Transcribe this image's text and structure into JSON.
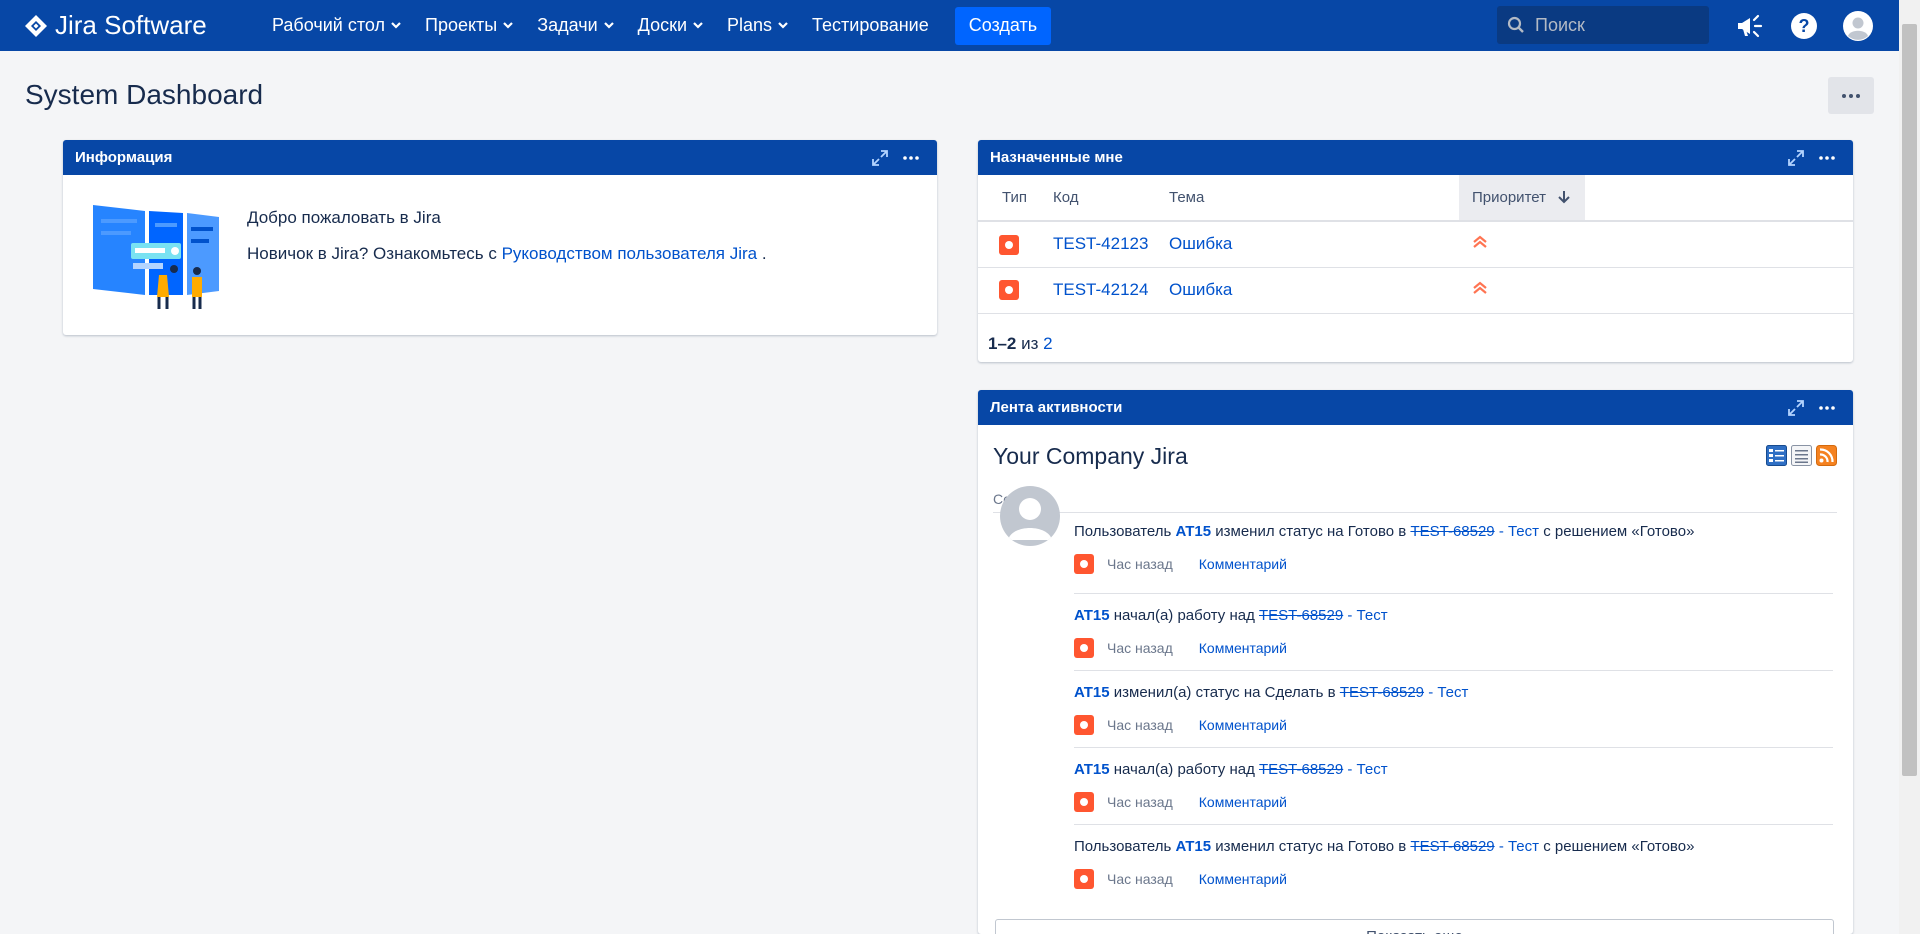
{
  "app": {
    "logo_text": "Jira Software"
  },
  "nav": {
    "items": [
      {
        "label": "Рабочий стол",
        "dropdown": true
      },
      {
        "label": "Проекты",
        "dropdown": true
      },
      {
        "label": "Задачи",
        "dropdown": true
      },
      {
        "label": "Доски",
        "dropdown": true
      },
      {
        "label": "Plans",
        "dropdown": true
      },
      {
        "label": "Тестирование",
        "dropdown": false
      }
    ],
    "create_label": "Создать",
    "search_placeholder": "Поиск",
    "icons": [
      "megaphone-icon",
      "help-icon",
      "user-avatar-icon"
    ]
  },
  "page": {
    "title": "System Dashboard",
    "more_icon": "ellipsis-icon"
  },
  "gadget_info": {
    "title": "Информация",
    "welcome": "Добро пожаловать в Jira",
    "newbie_prefix": "Новичок в Jira? Ознакомьтесь с ",
    "guide_link": "Руководством пользователя Jira",
    "newbie_suffix": " ."
  },
  "gadget_assigned": {
    "title": "Назначенные мне",
    "columns": {
      "type": "Тип",
      "key": "Код",
      "summary": "Тема",
      "priority": "Приоритет"
    },
    "rows": [
      {
        "key": "TEST-42123",
        "summary": "Ошибка",
        "type_icon": "bug-icon",
        "priority_icon": "priority-highest-icon"
      },
      {
        "key": "TEST-42124",
        "summary": "Ошибка",
        "type_icon": "bug-icon",
        "priority_icon": "priority-highest-icon"
      }
    ],
    "pager": {
      "range": "1–2",
      "of": "из",
      "total": "2"
    }
  },
  "gadget_activity": {
    "title": "Лента активности",
    "stream_title": "Your Company Jira",
    "day_label": "Сегодня",
    "entries": [
      {
        "prefix": "Пользователь ",
        "user": "AT15",
        "action": " изменил статус на Готово в ",
        "issue": "TEST-68529",
        "issue_title": " - Тест",
        "suffix": " с решением «Готово»",
        "time": "Час назад",
        "comment": "Комментарий"
      },
      {
        "prefix": "",
        "user": "AT15",
        "action": " начал(а) работу над ",
        "issue": "TEST-68529",
        "issue_title": " - Тест",
        "suffix": "",
        "time": "Час назад",
        "comment": "Комментарий"
      },
      {
        "prefix": "",
        "user": "AT15",
        "action": " изменил(а) статус на Сделать в ",
        "issue": "TEST-68529",
        "issue_title": " - Тест",
        "suffix": "",
        "time": "Час назад",
        "comment": "Комментарий"
      },
      {
        "prefix": "",
        "user": "AT15",
        "action": " начал(а) работу над ",
        "issue": "TEST-68529",
        "issue_title": " - Тест",
        "suffix": "",
        "time": "Час назад",
        "comment": "Комментарий"
      },
      {
        "prefix": "Пользователь ",
        "user": "AT15",
        "action": " изменил статус на Готово в ",
        "issue": "TEST-68529",
        "issue_title": " - Тест",
        "suffix": " с решением «Готово»",
        "time": "Час назад",
        "comment": "Комментарий"
      }
    ],
    "show_more": "Показать еще"
  },
  "colors": {
    "header_blue": "#0747a6",
    "create_blue": "#0065ff",
    "link_blue": "#0052cc",
    "bug_red": "#ff5630",
    "priority_orange": "#ff7452",
    "page_bg": "#f4f5f7"
  }
}
